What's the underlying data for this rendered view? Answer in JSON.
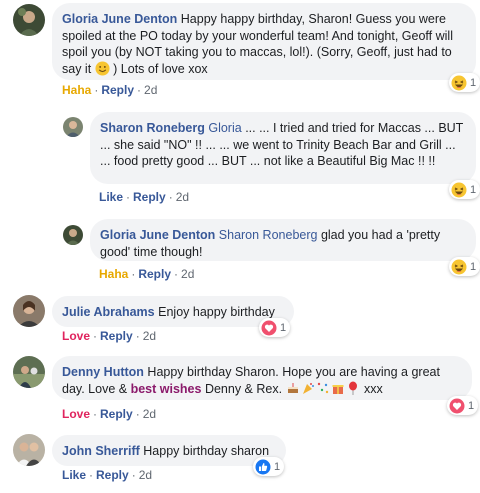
{
  "comments": [
    {
      "author": "Gloria June Denton",
      "text": "Happy happy birthday, Sharon! Guess you were spoiled at the PO today by your wonderful team! And tonight, Geoff will spoil you (by NOT taking you to maccas, lol!). (Sorry, Geoff, just had to say it",
      "text_after_emoji": ") Lots of love xox",
      "reaction_label": "Haha",
      "reply_label": "Reply",
      "time": "2d",
      "reaction_count": "1"
    },
    {
      "author": "Sharon Roneberg",
      "mention": "Gloria",
      "text": "... ... I tried and tried for Maccas ... BUT ... she said \"NO\" !! ... ... we went to Trinity Beach Bar and Grill ... ... food pretty good ... BUT ... not like a Beautiful Big Mac !! !!",
      "reaction_label": "Like",
      "reply_label": "Reply",
      "time": "2d",
      "reaction_count": "1"
    },
    {
      "author": "Gloria June Denton",
      "mention": "Sharon Roneberg",
      "text": "glad you had a 'pretty good' time though!",
      "reaction_label": "Haha",
      "reply_label": "Reply",
      "time": "2d",
      "reaction_count": "1"
    },
    {
      "author": "Julie Abrahams",
      "text": "Enjoy happy birthday",
      "reaction_label": "Love",
      "reply_label": "Reply",
      "time": "2d",
      "reaction_count": "1"
    },
    {
      "author": "Denny Hutton",
      "text": "Happy birthday Sharon. Hope you are having a great day. Love &",
      "highlight": "best wishes",
      "text_after_highlight": "Denny & Rex.",
      "text_end": "xxx",
      "reaction_label": "Love",
      "reply_label": "Reply",
      "time": "2d",
      "reaction_count": "1"
    },
    {
      "author": "John Sherriff",
      "text": "Happy birthday sharon",
      "reaction_label": "Like",
      "reply_label": "Reply",
      "time": "2d",
      "reaction_count": "1"
    }
  ],
  "separator": "·",
  "colors": {
    "link": "#385898",
    "haha": "#e7a800",
    "love": "#e0245e",
    "bubble": "#f2f3f5"
  }
}
